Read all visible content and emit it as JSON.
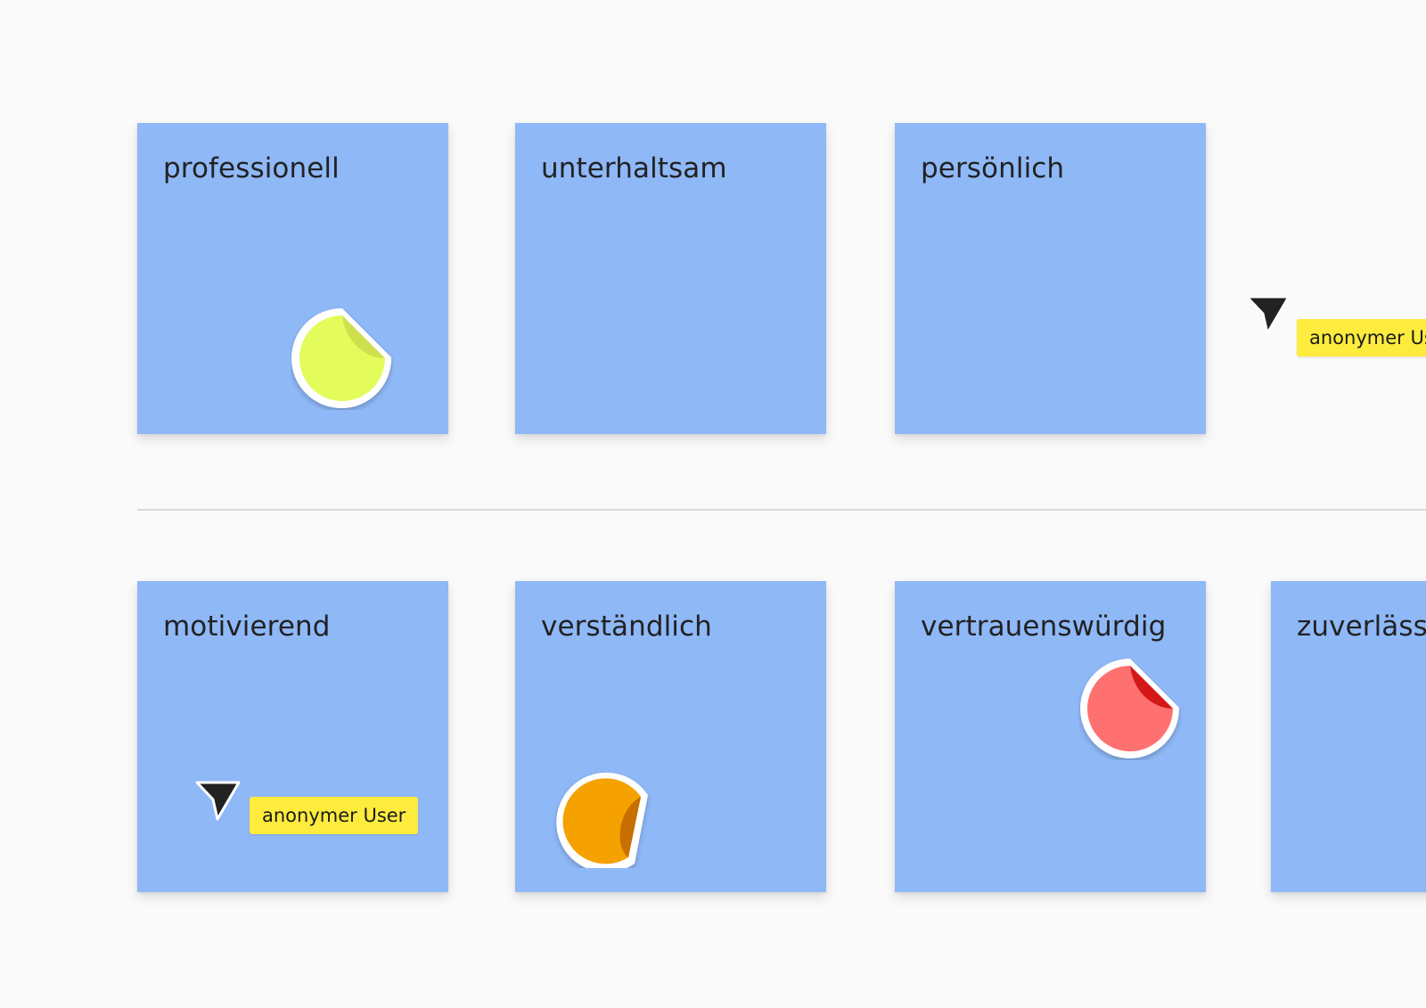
{
  "board": {
    "background": "#fafafa",
    "note_color": "#8fb8f7",
    "row1": [
      {
        "label": "professionell"
      },
      {
        "label": "unterhaltsam"
      },
      {
        "label": "persönlich"
      }
    ],
    "row2": [
      {
        "label": "motivierend"
      },
      {
        "label": "verständlich"
      },
      {
        "label": "vertrauenswürdig"
      },
      {
        "label": "zuverlässig"
      }
    ]
  },
  "stickers": [
    {
      "name": "sticker-yellow-green",
      "fill": "#e4fb5c",
      "curl": "#cde04d",
      "icon": "peeling-dot-sticker"
    },
    {
      "name": "sticker-orange",
      "fill": "#f5a100",
      "curl": "#c76f00",
      "icon": "peeling-dot-sticker"
    },
    {
      "name": "sticker-red",
      "fill": "#ff7070",
      "curl": "#d41717",
      "icon": "peeling-dot-sticker"
    }
  ],
  "cursors": [
    {
      "user": "anonymer User",
      "icon": "pointer-cursor-icon"
    },
    {
      "user": "anonymer User",
      "icon": "pointer-cursor-icon"
    }
  ],
  "colors": {
    "cursor": "#222222",
    "user_tag": "#fdeb3d",
    "divider": "#d9d9d9"
  }
}
